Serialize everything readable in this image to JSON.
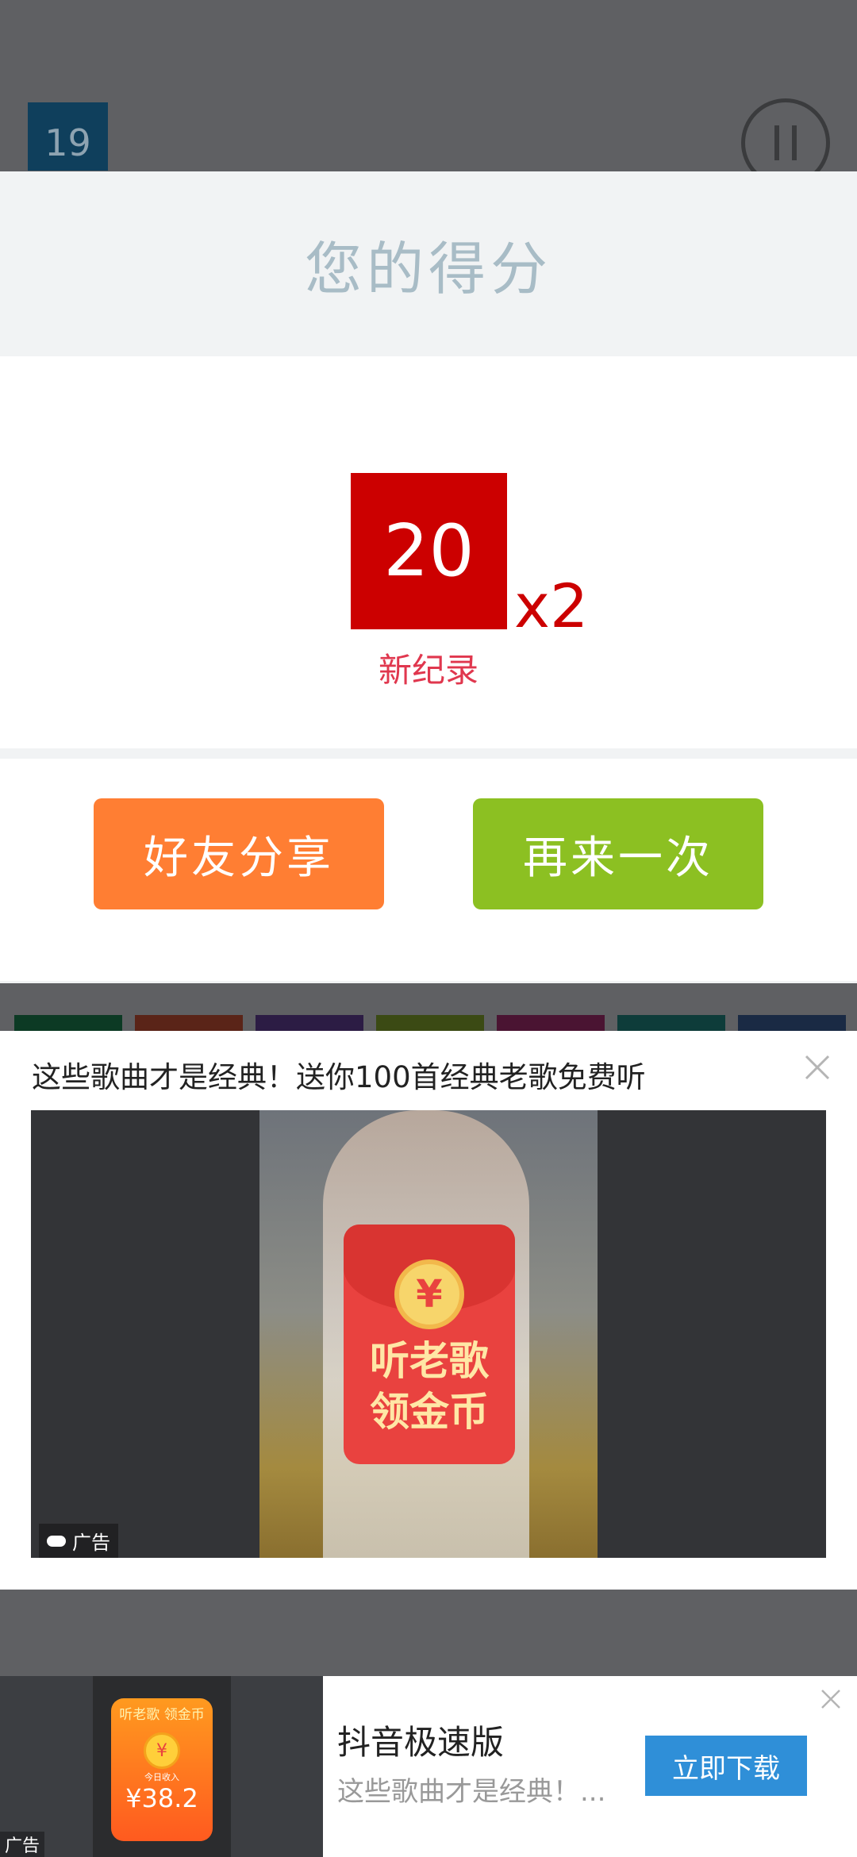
{
  "game": {
    "level": "19",
    "pause_icon": "pause-icon"
  },
  "dialog": {
    "title": "您的得分",
    "score": "20",
    "multiplier": "x2",
    "record_label": "新纪录",
    "share_button": "好友分享",
    "retry_button": "再来一次",
    "colors": {
      "score": "#cc0000",
      "share": "#ff7e33",
      "retry": "#8cc022"
    }
  },
  "ad": {
    "title": "这些歌曲才是经典！送你100首经典老歌免费听",
    "coin_symbol": "¥",
    "envelope_text": "听老歌\n领金币",
    "tag": "广告",
    "close_icon": "close-icon"
  },
  "banner": {
    "card_title": "听老歌 领金币",
    "coin_symbol": "¥",
    "card_sub": "今日收入",
    "card_amount": "¥38.2",
    "tag": "广告",
    "app_name": "抖音极速版",
    "description": "这些歌曲才是经典！...",
    "download_button": "立即下载",
    "close_icon": "close-icon"
  }
}
